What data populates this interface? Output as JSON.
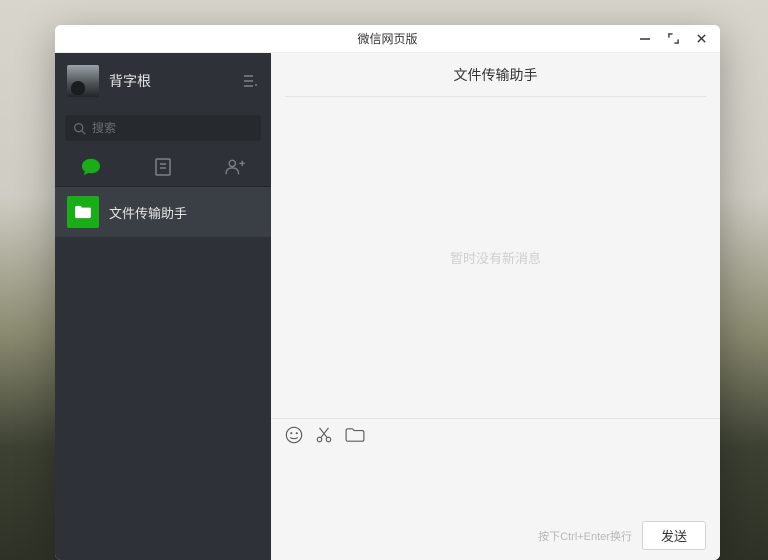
{
  "titlebar": {
    "title": "微信网页版"
  },
  "profile": {
    "name": "背字根"
  },
  "search": {
    "placeholder": "搜索"
  },
  "conversations": [
    {
      "name": "文件传输助手"
    }
  ],
  "chat": {
    "header_name": "文件传输助手",
    "empty_text": "暂时没有新消息",
    "send_hint": "按下Ctrl+Enter换行",
    "send_label": "发送"
  }
}
